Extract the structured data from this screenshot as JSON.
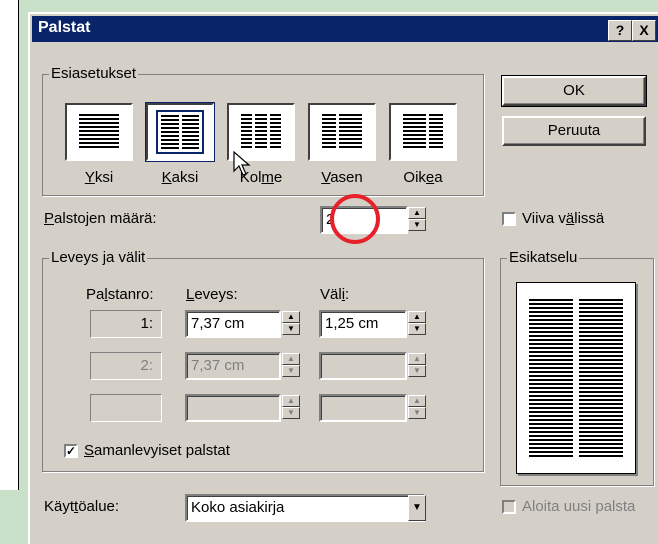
{
  "dialog": {
    "title": "Palstat",
    "help_button": "?",
    "close_button": "X"
  },
  "presets": {
    "group_label": "Esiasetukset",
    "items": [
      {
        "label_pre": "",
        "label_key": "Y",
        "label_post": "ksi"
      },
      {
        "label_pre": "",
        "label_key": "K",
        "label_post": "aksi"
      },
      {
        "label_pre": "Kol",
        "label_key": "m",
        "label_post": "e"
      },
      {
        "label_pre": "",
        "label_key": "V",
        "label_post": "asen"
      },
      {
        "label_pre": "Oik",
        "label_key": "e",
        "label_post": "a"
      }
    ]
  },
  "buttons": {
    "ok": "OK",
    "cancel": "Peruuta"
  },
  "column_count": {
    "label_key": "P",
    "label_post": "alstojen määrä:",
    "value": "2"
  },
  "line_between": {
    "label_pre": "Viiva v",
    "label_key": "ä",
    "label_post": "lissä",
    "checked": false
  },
  "width_spacing": {
    "group_label": "Leveys ja välit",
    "header_column_pre": "Pa",
    "header_column_key": "l",
    "header_column_post": "stanro:",
    "header_width_key": "L",
    "header_width_post": "eveys:",
    "header_spacing_pre": "Väl",
    "header_spacing_key": "i",
    "header_spacing_post": ":",
    "rows": [
      {
        "number": "1:",
        "width": "7,37 cm",
        "spacing": "1,25 cm"
      },
      {
        "number": "2:",
        "width": "7,37 cm",
        "spacing": ""
      },
      {
        "number": "",
        "width": "",
        "spacing": ""
      }
    ]
  },
  "equal_width": {
    "label_key": "S",
    "label_post": "amanlevyiset palstat",
    "checked": true,
    "check_mark": "✓"
  },
  "preview": {
    "group_label": "Esikatselu"
  },
  "apply_to": {
    "label_pre": "Käyt",
    "label_key": "t",
    "label_post": "öalue:",
    "value": "Koko asiakirja",
    "dropdown_arrow": "▼"
  },
  "new_column": {
    "label": "Aloita uusi palsta",
    "checked": false
  },
  "spinner": {
    "up": "▲",
    "down": "▼"
  },
  "annotation_color": "#e8202a"
}
